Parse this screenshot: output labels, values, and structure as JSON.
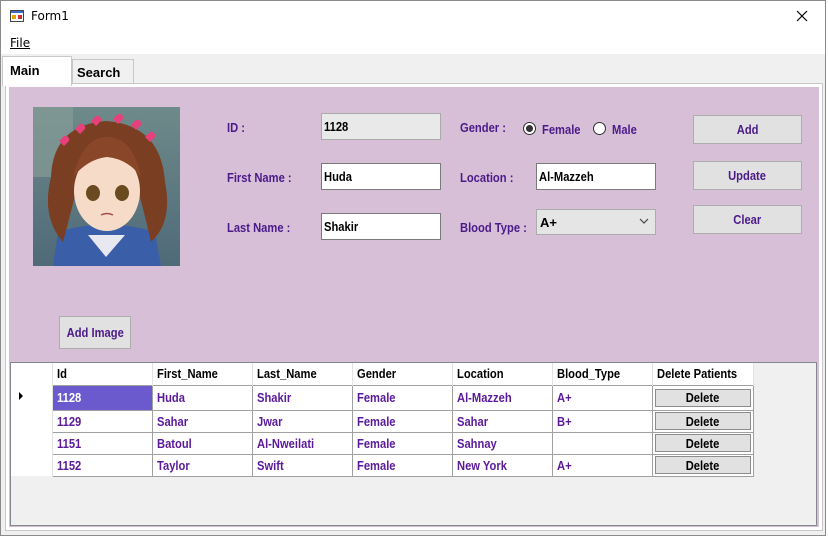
{
  "window": {
    "title": "Form1"
  },
  "menu": {
    "file": "File"
  },
  "tabs": [
    {
      "label": "Main"
    },
    {
      "label": "Search"
    }
  ],
  "form": {
    "id_label": "ID :",
    "id_value": "1128",
    "first_name_label": "First Name :",
    "first_name_value": "Huda",
    "last_name_label": "Last Name :",
    "last_name_value": "Shakir",
    "gender_label": "Gender :",
    "gender_options": [
      "Female",
      "Male"
    ],
    "gender_selected": "Female",
    "location_label": "Location :",
    "location_value": "Al-Mazzeh",
    "blood_type_label": "Blood Type :",
    "blood_type_value": "A+"
  },
  "buttons": {
    "add": "Add",
    "update": "Update",
    "clear": "Clear",
    "add_image": "Add Image"
  },
  "grid": {
    "columns": [
      "Id",
      "First_Name",
      "Last_Name",
      "Gender",
      "Location",
      "Blood_Type",
      "Delete Patients"
    ],
    "rows": [
      {
        "id": "1128",
        "first": "Huda",
        "last": "Shakir",
        "gender": "Female",
        "location": "Al-Mazzeh",
        "blood": "A+",
        "action": "Delete"
      },
      {
        "id": "1129",
        "first": "Sahar",
        "last": "Jwar",
        "gender": "Female",
        "location": "Sahar",
        "blood": "B+",
        "action": "Delete"
      },
      {
        "id": "1151",
        "first": "Batoul",
        "last": "Al-Nweilati",
        "gender": "Female",
        "location": "Sahnay",
        "blood": "",
        "action": "Delete"
      },
      {
        "id": "1152",
        "first": "Taylor",
        "last": "Swift",
        "gender": "Female",
        "location": "New York",
        "blood": "A+",
        "action": "Delete"
      }
    ],
    "selected_row": 0
  },
  "colors": {
    "form_background": "#d8bfd8",
    "label_text": "#4b1a8a",
    "selection": "#6a5acd"
  }
}
